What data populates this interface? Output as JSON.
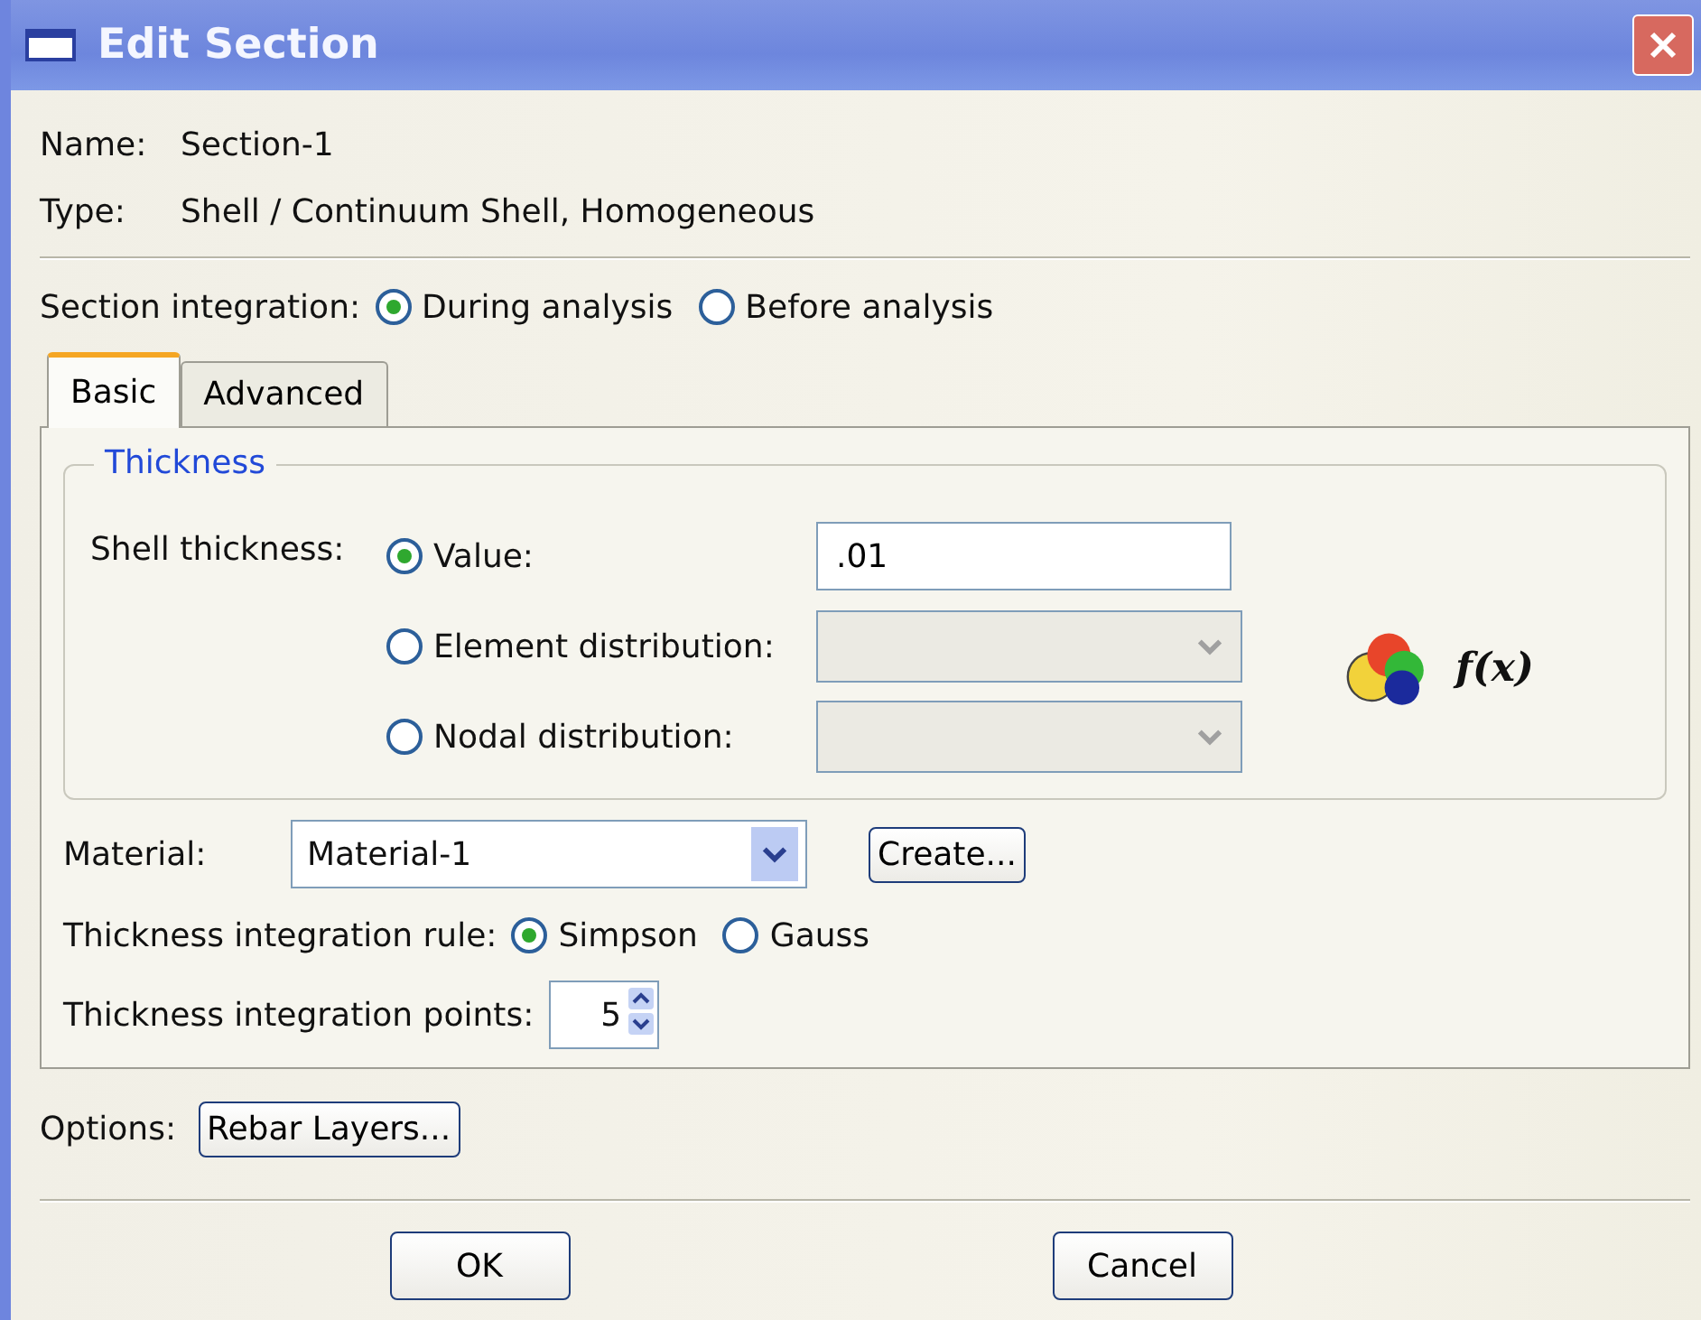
{
  "window": {
    "title": "Edit Section"
  },
  "fields": [
    {
      "label": "Name:",
      "value": "Section-1"
    },
    {
      "label": "Type:",
      "value": "Shell / Continuum Shell, Homogeneous"
    }
  ],
  "section_integration": {
    "label": "Section integration:",
    "options": [
      {
        "label": "During analysis",
        "selected": true
      },
      {
        "label": "Before analysis",
        "selected": false
      }
    ]
  },
  "tabs": [
    {
      "label": "Basic",
      "selected": true
    },
    {
      "label": "Advanced",
      "selected": false
    }
  ],
  "thickness": {
    "title": "Thickness",
    "label": "Shell thickness:",
    "function_label": "f(x)",
    "options": [
      {
        "kind": "text",
        "label": "Value:",
        "selected": true,
        "value": ".01"
      },
      {
        "kind": "dropdown",
        "label": "Element distribution:",
        "selected": false,
        "disabled": true
      },
      {
        "kind": "dropdown",
        "label": "Nodal distribution:",
        "selected": false,
        "disabled": true
      }
    ]
  },
  "material": {
    "label": "Material:",
    "value": "Material-1",
    "button": "Create..."
  },
  "integration_rule": {
    "label": "Thickness integration rule:",
    "options": [
      {
        "label": "Simpson",
        "selected": true
      },
      {
        "label": "Gauss",
        "selected": false
      }
    ]
  },
  "integration_points": {
    "label": "Thickness integration points:",
    "value": "5"
  },
  "options": {
    "label": "Options:",
    "button": "Rebar Layers..."
  },
  "buttons": [
    "OK",
    "Cancel"
  ]
}
